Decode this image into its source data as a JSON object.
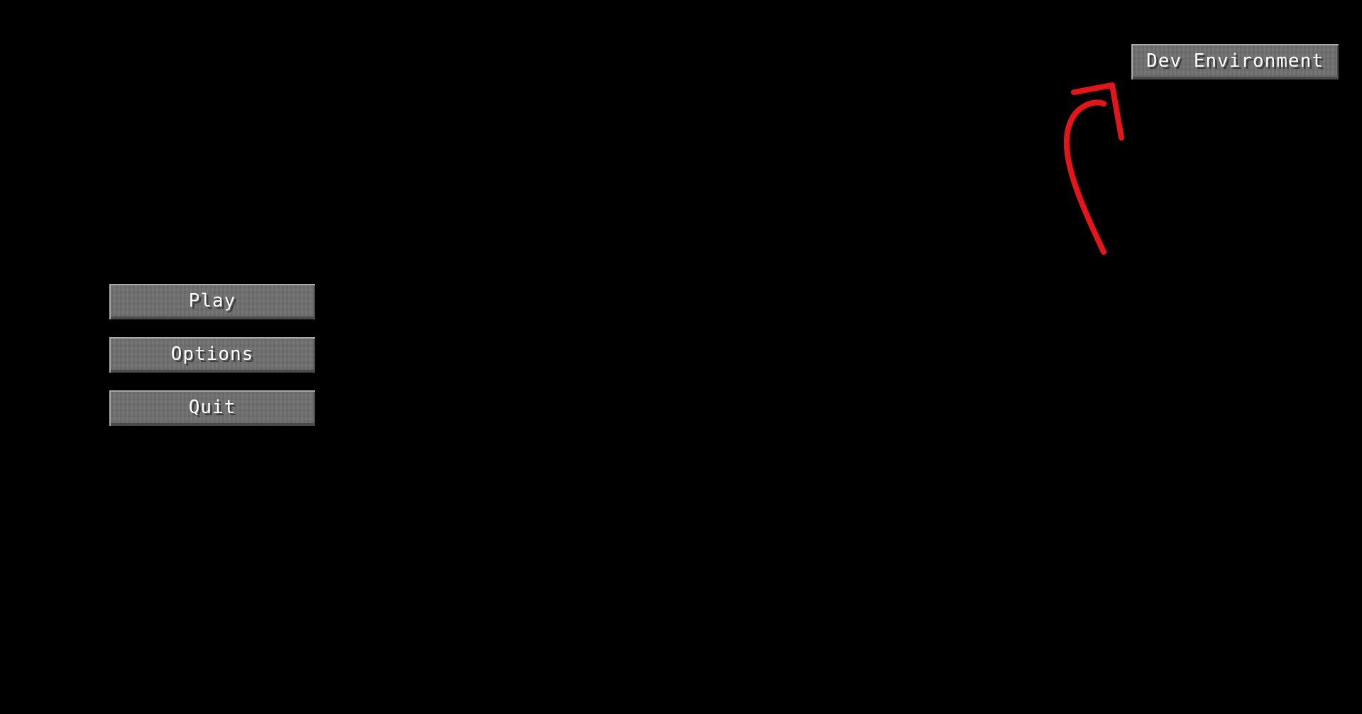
{
  "menu": {
    "play_label": "Play",
    "options_label": "Options",
    "quit_label": "Quit"
  },
  "corner": {
    "dev_label": "Dev Environment"
  },
  "colors": {
    "background": "#000000",
    "button_face": "#6f6f6f",
    "button_text": "#ffffff",
    "annotation_arrow": "#e4141b"
  },
  "icons": {
    "annotation": "red-arrow-icon"
  }
}
